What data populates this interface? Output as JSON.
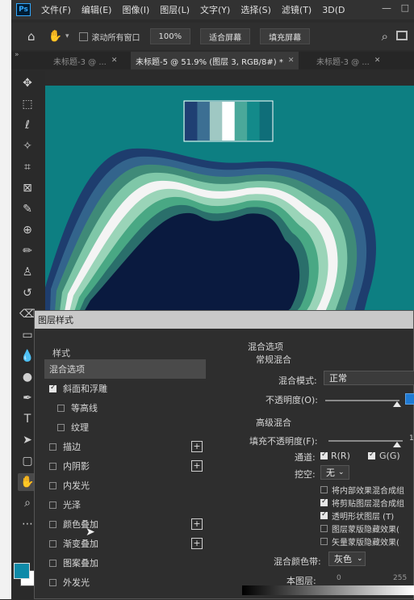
{
  "menubar": {
    "logo": "Ps",
    "items": [
      "文件(F)",
      "编辑(E)",
      "图像(I)",
      "图层(L)",
      "文字(Y)",
      "选择(S)",
      "滤镜(T)",
      "3D(D"
    ]
  },
  "options": {
    "scroll_all_label": "滚动所有窗口",
    "zoom_value": "100%",
    "fit_screen_label": "适合屏幕",
    "fill_screen_label": "填充屏幕"
  },
  "tabs": [
    {
      "label": "未标题-3 @ ..."
    },
    {
      "label": "未标题-5 @ 51.9% (图层 3, RGB/8#) *"
    },
    {
      "label": "未标题-3 @ ..."
    }
  ],
  "palette": [
    "#1f3f73",
    "#3c6f93",
    "#9fc8c3",
    "#ffffff",
    "#4aa89a",
    "#138a8a",
    "#0f6e79"
  ],
  "canvas": {
    "background": "#0d7f82",
    "layers": [
      "#1e3d6e",
      "#33648c",
      "#3f8a78",
      "#7fc7a8",
      "#f4f4f4",
      "#9ad4b8",
      "#49a884",
      "#2a6f6b",
      "#0a1a3f"
    ]
  },
  "dialog": {
    "title": "图层样式",
    "sidebar_header": "样式",
    "items": [
      {
        "label": "混合选项",
        "checkbox": false,
        "checked": false,
        "plus": false,
        "active": true,
        "indent": false
      },
      {
        "label": "斜面和浮雕",
        "checkbox": true,
        "checked": true,
        "plus": false,
        "active": false,
        "indent": false
      },
      {
        "label": "等高线",
        "checkbox": true,
        "checked": false,
        "plus": false,
        "active": false,
        "indent": true
      },
      {
        "label": "纹理",
        "checkbox": true,
        "checked": false,
        "plus": false,
        "active": false,
        "indent": true
      },
      {
        "label": "描边",
        "checkbox": true,
        "checked": false,
        "plus": true,
        "active": false,
        "indent": false
      },
      {
        "label": "内阴影",
        "checkbox": true,
        "checked": false,
        "plus": true,
        "active": false,
        "indent": false
      },
      {
        "label": "内发光",
        "checkbox": true,
        "checked": false,
        "plus": false,
        "active": false,
        "indent": false
      },
      {
        "label": "光泽",
        "checkbox": true,
        "checked": false,
        "plus": false,
        "active": false,
        "indent": false
      },
      {
        "label": "颜色叠加",
        "checkbox": true,
        "checked": false,
        "plus": true,
        "active": false,
        "indent": false
      },
      {
        "label": "渐变叠加",
        "checkbox": true,
        "checked": false,
        "plus": true,
        "active": false,
        "indent": false
      },
      {
        "label": "图案叠加",
        "checkbox": true,
        "checked": false,
        "plus": false,
        "active": false,
        "indent": false
      },
      {
        "label": "外发光",
        "checkbox": true,
        "checked": false,
        "plus": false,
        "active": false,
        "indent": false
      }
    ],
    "blend_section_title": "混合选项",
    "general_blend_title": "常规混合",
    "blend_mode_label": "混合模式:",
    "blend_mode_value": "正常",
    "opacity_label": "不透明度(O):",
    "advanced_blend_title": "高级混合",
    "fill_opacity_label": "填充不透明度(F):",
    "fill_opacity_value": "1",
    "channels_label": "通道:",
    "channel_r_label": "R(R)",
    "channel_g_label": "G(G)",
    "knockout_label": "挖空:",
    "knockout_value": "无",
    "options": [
      {
        "label": "将内部效果混合成组",
        "checked": false
      },
      {
        "label": "将剪贴图层混合成组",
        "checked": true
      },
      {
        "label": "透明形状图层 (T)",
        "checked": true
      },
      {
        "label": "图层蒙版隐藏效果(",
        "checked": false
      },
      {
        "label": "矢量蒙版隐藏效果(",
        "checked": false
      }
    ],
    "blend_if_label": "混合颜色带:",
    "blend_if_value": "灰色",
    "this_layer_label": "本图层:",
    "this_layer_min": "0",
    "this_layer_max": "255"
  }
}
